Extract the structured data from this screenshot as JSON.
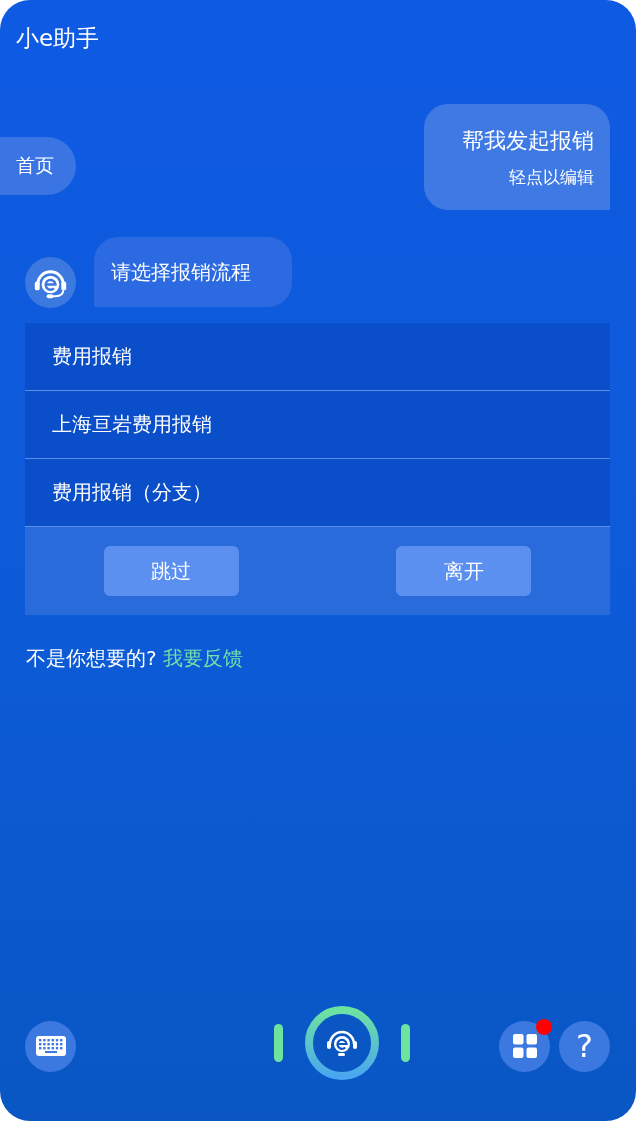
{
  "header": {
    "title": "小e助手"
  },
  "home_chip": {
    "label": "首页"
  },
  "user_message": {
    "text": "帮我发起报销",
    "hint": "轻点以编辑"
  },
  "bot_message": {
    "text": "请选择报销流程"
  },
  "options": [
    {
      "label": "费用报销"
    },
    {
      "label": "上海亘岩费用报销"
    },
    {
      "label": "费用报销（分支）"
    }
  ],
  "actions": [
    {
      "label": "跳过"
    },
    {
      "label": "离开"
    }
  ],
  "feedback": {
    "text": "不是你想要的?",
    "link": "我要反馈"
  },
  "bottom_bar": {
    "apps_badge": true,
    "help_label": "?"
  }
}
